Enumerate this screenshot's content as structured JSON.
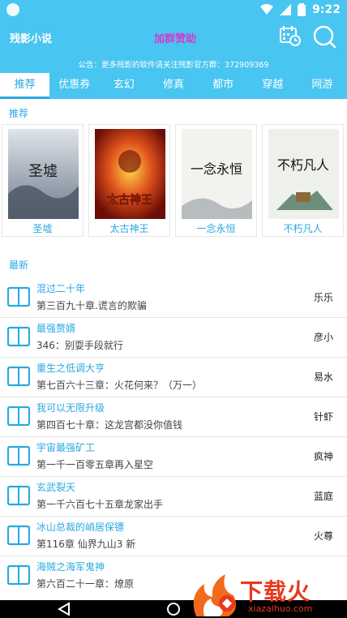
{
  "status_bar": {
    "time": "9:22"
  },
  "app_bar": {
    "title": "残影小说",
    "center_link": "加群赞助",
    "notice": "公告：更多残影的软件请关注残影官方群：372909369"
  },
  "tabs": [
    {
      "label": "推荐",
      "active": true
    },
    {
      "label": "优惠券"
    },
    {
      "label": "玄幻"
    },
    {
      "label": "修真"
    },
    {
      "label": "都市"
    },
    {
      "label": "穿越"
    },
    {
      "label": "网游"
    }
  ],
  "recommend": {
    "title": "推荐",
    "books": [
      {
        "name": "圣墟",
        "cover_text": "圣墟"
      },
      {
        "name": "太古神王",
        "cover_text": "太古神王"
      },
      {
        "name": "一念永恒",
        "cover_text": "一念永恒"
      },
      {
        "name": "不朽凡人",
        "cover_text": "不朽凡人"
      }
    ]
  },
  "latest": {
    "title": "最新",
    "items": [
      {
        "title": "混过二十年",
        "chapter": "第三百九十章.谎言的欺骗",
        "author": "乐乐"
      },
      {
        "title": "最强赘婿",
        "chapter": "346：别耍手段就行",
        "author": "彦小"
      },
      {
        "title": "重生之低调大亨",
        "chapter": "第七百六十三章：火花何来？（万一）",
        "author": "易水"
      },
      {
        "title": "我可以无限升级",
        "chapter": "第四百七十章：这龙宫都没你值钱",
        "author": "针虾"
      },
      {
        "title": "宇宙最强矿工",
        "chapter": "第一千一百零五章再入星空",
        "author": "疯神"
      },
      {
        "title": "玄武裂天",
        "chapter": "第一千六百七十五章龙家出手",
        "author": "蓝庭"
      },
      {
        "title": "冰山总裁的峭居保镖",
        "chapter": "第116章 仙界九山3 新",
        "author": "火尊"
      },
      {
        "title": "海贼之海军鬼神",
        "chapter": "第六百二十一章：燎原",
        "author": ""
      }
    ]
  },
  "watermark": {
    "text": "下载火",
    "url": "xiazaihuo.com"
  },
  "colors": {
    "primary": "#49c5f2",
    "accent": "#2aa9e0",
    "highlight": "#d23bd0"
  }
}
